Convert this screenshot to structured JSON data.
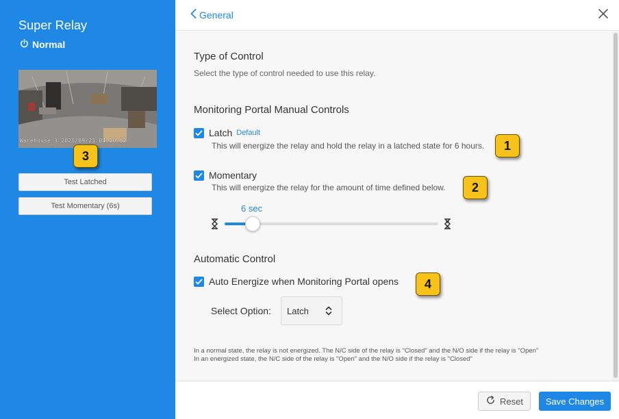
{
  "sidebar": {
    "device_name": "Super Relay",
    "status_icon": "power-icon",
    "status": "Normal",
    "camera_timestamp": "Warehouse 3 2021/09/21 04:10:52",
    "test_latched_label": "Test Latched",
    "test_momentary_label": "Test Momentary (6s)"
  },
  "header": {
    "back_label": "General",
    "back_icon": "chevron-left-icon",
    "close_icon": "close-icon"
  },
  "type_of_control": {
    "title": "Type of Control",
    "subtitle": "Select the type of control needed to use this relay."
  },
  "manual_controls": {
    "title": "Monitoring Portal Manual Controls",
    "latch": {
      "label": "Latch",
      "tag": "Default",
      "checked": true,
      "description": "This will energize the relay and hold the relay in a latched state for 6 hours."
    },
    "momentary": {
      "label": "Momentary",
      "checked": true,
      "description": "This will energize the relay for the amount of time defined below."
    },
    "slider": {
      "value_label": "6 sec",
      "fraction": 0.13,
      "min_icon": "hourglass-empty-icon",
      "max_icon": "hourglass-full-icon"
    }
  },
  "automatic_control": {
    "title": "Automatic Control",
    "auto_energize": {
      "label": "Auto Energize when Monitoring Portal opens",
      "checked": true
    },
    "select_label": "Select Option:",
    "select_value": "Latch"
  },
  "notes": {
    "line1": "In a normal state, the relay is not energized. The N/C side of the relay is \"Closed\" and the N/O side if the relay is \"Open\"",
    "line2": "In an energized state, the N/C side of the relay is \"Open\" and the N/O side if the relay is \"Closed\""
  },
  "footer": {
    "reset_label": "Reset",
    "save_label": "Save Changes"
  },
  "badges": [
    "1",
    "2",
    "3",
    "4"
  ],
  "colors": {
    "accent": "#1f88e5",
    "badge": "#f7c21a"
  }
}
